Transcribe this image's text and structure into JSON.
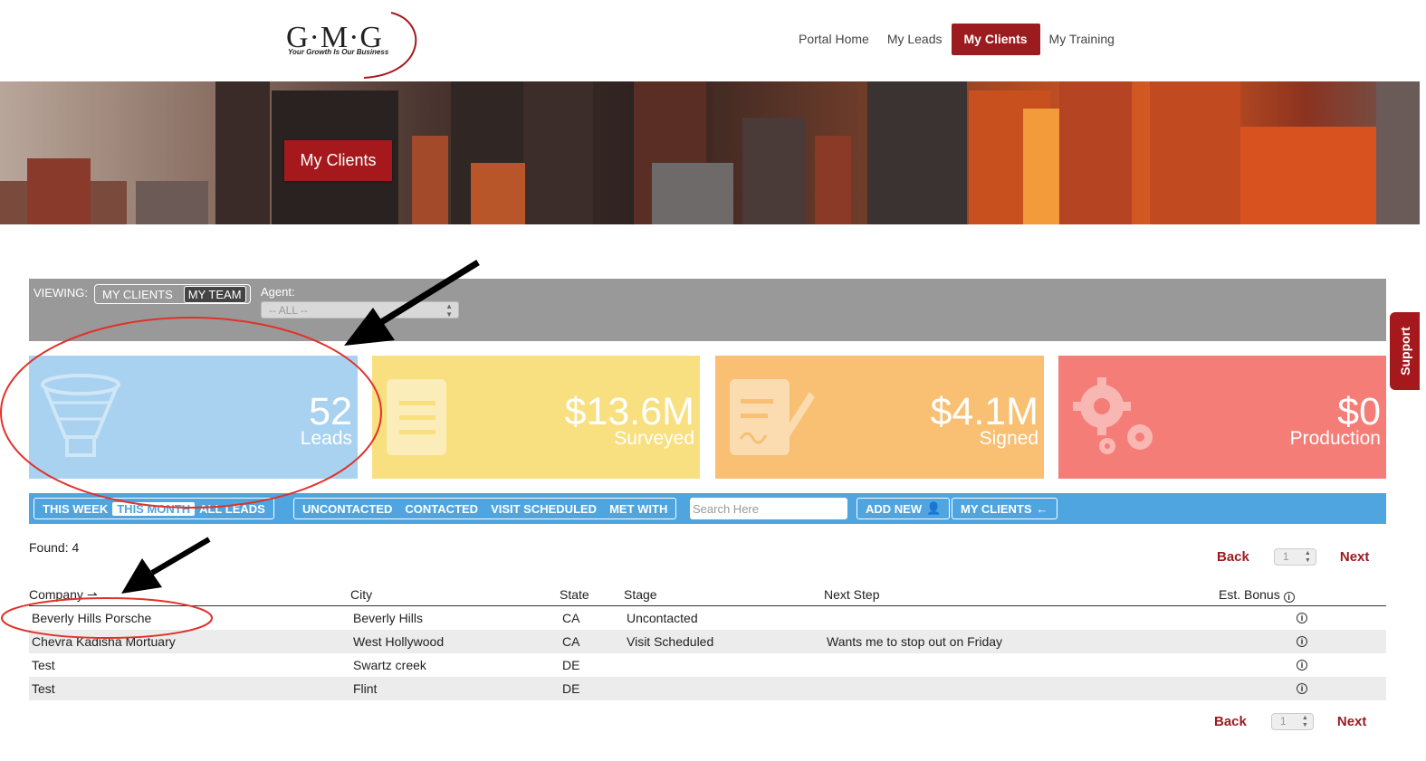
{
  "header": {
    "logo_text": "G·M·G",
    "logo_tagline": "Your Growth Is Our Business",
    "nav": [
      {
        "label": "Portal Home",
        "active": false
      },
      {
        "label": "My Leads",
        "active": false
      },
      {
        "label": "My Clients",
        "active": true
      },
      {
        "label": "My Training",
        "active": false
      }
    ]
  },
  "banner": {
    "title": "My Clients"
  },
  "support": {
    "label": "Support"
  },
  "viewing": {
    "label": "VIEWING:",
    "options": [
      {
        "label": "MY CLIENTS",
        "active": false
      },
      {
        "label": "MY TEAM",
        "active": true
      }
    ],
    "agent_label": "Agent:",
    "agent_value": "-- ALL --"
  },
  "stats": [
    {
      "value": "52",
      "label": "Leads",
      "color": "#a8d2f0",
      "icon": "funnel-icon"
    },
    {
      "value": "$13.6M",
      "label": "Surveyed",
      "color": "#f8df7f",
      "icon": "document-icon"
    },
    {
      "value": "$4.1M",
      "label": "Signed",
      "color": "#f9bf72",
      "icon": "signed-document-icon"
    },
    {
      "value": "$0",
      "label": "Production",
      "color": "#f57d77",
      "icon": "gears-icon"
    }
  ],
  "filters": {
    "period": [
      {
        "label": "THIS WEEK",
        "active": false
      },
      {
        "label": "THIS MONTH",
        "active": true
      },
      {
        "label": "ALL LEADS",
        "active": false
      }
    ],
    "stages": [
      "UNCONTACTED",
      "CONTACTED",
      "VISIT SCHEDULED",
      "MET WITH"
    ],
    "search_placeholder": "Search Here",
    "add_new": "ADD NEW",
    "my_clients": "MY CLIENTS"
  },
  "found": "Found: 4",
  "pager": {
    "back": "Back",
    "next": "Next",
    "page": "1"
  },
  "table": {
    "headers": {
      "company": "Company",
      "city": "City",
      "state": "State",
      "stage": "Stage",
      "next_step": "Next Step",
      "bonus": "Est. Bonus"
    },
    "rows": [
      {
        "company": "Beverly Hills Porsche",
        "city": "Beverly Hills",
        "state": "CA",
        "stage": "Uncontacted",
        "next_step": ""
      },
      {
        "company": "Chevra Kadisha Mortuary",
        "city": "West Hollywood",
        "state": "CA",
        "stage": "Visit Scheduled",
        "next_step": "Wants me to stop out on Friday"
      },
      {
        "company": "Test",
        "city": "Swartz creek",
        "state": "DE",
        "stage": "",
        "next_step": ""
      },
      {
        "company": "Test",
        "city": "Flint",
        "state": "DE",
        "stage": "",
        "next_step": ""
      }
    ]
  },
  "colors": {
    "brand_red": "#9b1b1e",
    "filter_blue": "#4ea5e0",
    "viewing_gray": "#999999",
    "annotation_red": "#e0322a"
  }
}
